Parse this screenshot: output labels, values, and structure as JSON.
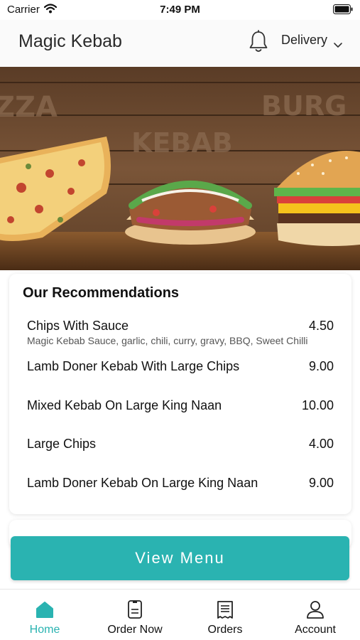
{
  "status_bar": {
    "carrier": "Carrier",
    "time": "7:49 PM"
  },
  "header": {
    "title": "Magic Kebab",
    "mode": "Delivery"
  },
  "hero": {
    "banner_words": [
      "ZZA",
      "KEBAB",
      "BURG"
    ]
  },
  "recommendations": {
    "title": "Our Recommendations",
    "items": [
      {
        "name": "Chips With Sauce",
        "price": "4.50",
        "description": "Magic Kebab Sauce, garlic, chili, curry, gravy, BBQ, Sweet Chilli"
      },
      {
        "name": "Lamb Doner Kebab With Large Chips",
        "price": "9.00"
      },
      {
        "name": "Mixed Kebab On Large King Naan",
        "price": "10.00"
      },
      {
        "name": "Large Chips",
        "price": "4.00"
      },
      {
        "name": "Lamb Doner Kebab On Large King Naan",
        "price": "9.00"
      }
    ]
  },
  "view_menu_label": "View Menu",
  "tabs": [
    {
      "label": "Home",
      "icon": "home-icon",
      "active": true
    },
    {
      "label": "Order Now",
      "icon": "order-icon",
      "active": false
    },
    {
      "label": "Orders",
      "icon": "receipt-icon",
      "active": false
    },
    {
      "label": "Account",
      "icon": "user-icon",
      "active": false
    }
  ],
  "colors": {
    "accent": "#2ab3b1",
    "header_bg": "#fafafa"
  }
}
